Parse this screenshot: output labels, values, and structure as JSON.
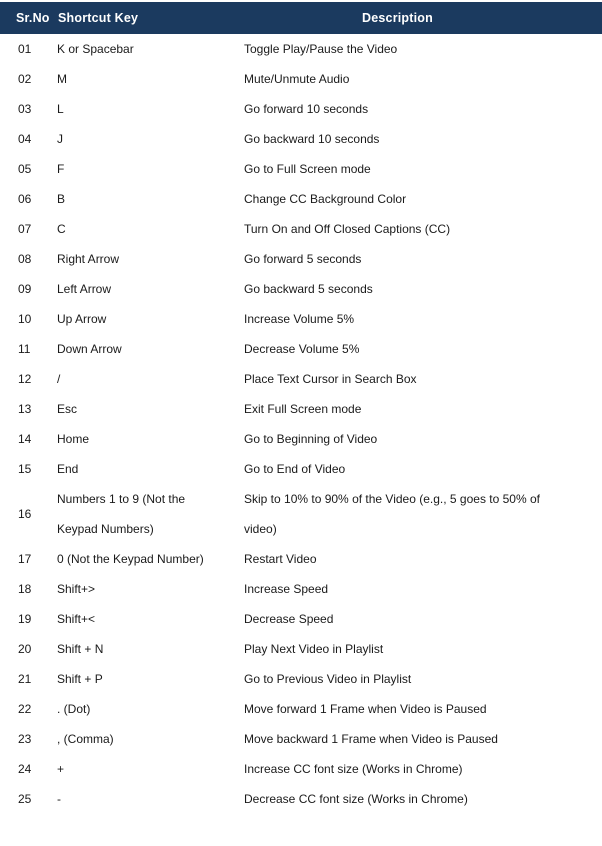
{
  "table": {
    "columns": {
      "sr_no": "Sr.No",
      "shortcut_key": "Shortcut Key",
      "description": "Description"
    },
    "header_bg": "#1b3a5f",
    "header_text_color": "#ffffff",
    "body_text_color": "#1a1a1a",
    "rows": [
      {
        "sr": "01",
        "key": "K or Spacebar",
        "desc": "Toggle Play/Pause the Video"
      },
      {
        "sr": "02",
        "key": "M",
        "desc": "Mute/Unmute Audio"
      },
      {
        "sr": "03",
        "key": "L",
        "desc": "Go forward 10 seconds"
      },
      {
        "sr": "04",
        "key": "J",
        "desc": "Go backward 10 seconds"
      },
      {
        "sr": "05",
        "key": "F",
        "desc": "Go to Full Screen mode"
      },
      {
        "sr": "06",
        "key": "B",
        "desc": "Change CC Background Color"
      },
      {
        "sr": "07",
        "key": "C",
        "desc": "Turn On and Off Closed Captions (CC)"
      },
      {
        "sr": "08",
        "key": "Right Arrow",
        "desc": "Go forward 5 seconds"
      },
      {
        "sr": "09",
        "key": "Left Arrow",
        "desc": "Go backward 5 seconds"
      },
      {
        "sr": "10",
        "key": "Up Arrow",
        "desc": "Increase Volume 5%"
      },
      {
        "sr": "11",
        "key": "Down Arrow",
        "desc": "Decrease Volume 5%"
      },
      {
        "sr": "12",
        "key": "/",
        "desc": "Place Text Cursor in Search Box"
      },
      {
        "sr": "13",
        "key": "Esc",
        "desc": "Exit Full Screen mode"
      },
      {
        "sr": "14",
        "key": "Home",
        "desc": "Go to Beginning of Video"
      },
      {
        "sr": "15",
        "key": "End",
        "desc": "Go to End of Video"
      },
      {
        "sr": "16",
        "key_line1": "Numbers 1 to 9 (Not the",
        "key_line2": "Keypad Numbers)",
        "desc_line1": "Skip to 10% to 90% of the Video (e.g., 5 goes to 50% of",
        "desc_line2": "video)"
      },
      {
        "sr": "17",
        "key": "0 (Not the Keypad Number)",
        "desc": "Restart Video"
      },
      {
        "sr": "18",
        "key": "Shift+>",
        "desc": "Increase Speed"
      },
      {
        "sr": "19",
        "key": "Shift+<",
        "desc": "Decrease Speed"
      },
      {
        "sr": "20",
        "key": "Shift + N",
        "desc": "Play Next Video in Playlist"
      },
      {
        "sr": "21",
        "key": "Shift + P",
        "desc": "Go to Previous Video in Playlist"
      },
      {
        "sr": "22",
        "key": ". (Dot)",
        "desc": "Move forward 1 Frame when Video is Paused"
      },
      {
        "sr": "23",
        "key": ", (Comma)",
        "desc": "Move backward 1 Frame when Video is Paused"
      },
      {
        "sr": "24",
        "key": "+",
        "desc": "Increase CC font size (Works in Chrome)"
      },
      {
        "sr": "25",
        "key": "-",
        "desc": "Decrease CC font size (Works in Chrome)"
      }
    ]
  }
}
